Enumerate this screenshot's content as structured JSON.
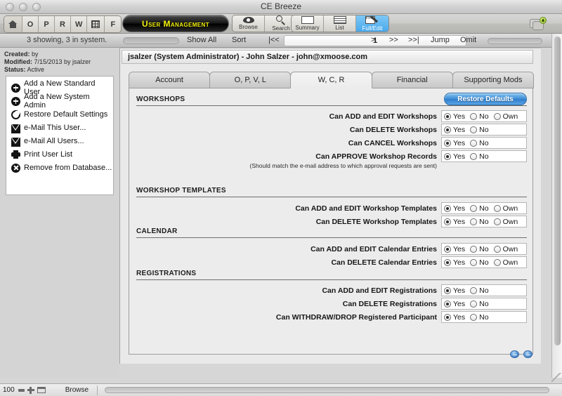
{
  "window": {
    "title": "CE Breeze",
    "traffic_lights": [
      "close",
      "minimize",
      "zoom"
    ]
  },
  "toolbar": {
    "nav_buttons": [
      {
        "name": "home",
        "label": "",
        "icon": "house-icon"
      },
      {
        "name": "o",
        "label": "O",
        "icon": ""
      },
      {
        "name": "p",
        "label": "P",
        "icon": ""
      },
      {
        "name": "r",
        "label": "R",
        "icon": ""
      },
      {
        "name": "w",
        "label": "W",
        "icon": ""
      },
      {
        "name": "grid",
        "label": "",
        "icon": "grid-icon"
      },
      {
        "name": "f",
        "label": "F",
        "icon": ""
      }
    ],
    "app_title": "User Management",
    "app_title_color": "#f2f008",
    "mode_buttons": [
      {
        "name": "browse",
        "label": "Browse",
        "icon": "eye-icon",
        "selected": false
      },
      {
        "name": "search",
        "label": "Search",
        "icon": "magnifier-icon",
        "selected": false
      }
    ],
    "view_buttons": [
      {
        "name": "summary",
        "label": "Summary",
        "icon": "summary-icon",
        "selected": false
      },
      {
        "name": "list",
        "label": "List",
        "icon": "list-icon",
        "selected": false
      },
      {
        "name": "full-edit",
        "label": "Full/Edit",
        "icon": "pencil-icon",
        "selected": true
      }
    ],
    "selected_accent": "#49a9ec",
    "new_window_icon": "new-window-icon"
  },
  "navstrip": {
    "found_count": "3 showing, 3 in system.",
    "show_all": "Show All",
    "sort": "Sort",
    "first": "|<<",
    "prev_set": "<<",
    "prev": "<",
    "page": "1",
    "next": ">",
    "next_set": ">>",
    "last": ">>|",
    "jump": "Jump",
    "omit": "Omit"
  },
  "sidebar": {
    "meta": {
      "created_label": "Created:",
      "created_value": "by",
      "modified_label": "Modified:",
      "modified_value": "7/15/2013 by jsalzer",
      "status_label": "Status:",
      "status_value": "Active"
    },
    "actions": [
      {
        "label": "Add a New Standard User",
        "icon": "plus-circle-icon"
      },
      {
        "label": "Add a New System Admin",
        "icon": "plus-circle-icon"
      },
      {
        "label": "Restore Default Settings",
        "icon": "refresh-circle-icon"
      },
      {
        "label": "e-Mail This User...",
        "icon": "envelope-icon"
      },
      {
        "label": "e-Mail All Users...",
        "icon": "envelope-icon"
      },
      {
        "label": "Print User List",
        "icon": "printer-icon"
      },
      {
        "label": "Remove from Database...",
        "icon": "x-circle-icon"
      }
    ]
  },
  "main": {
    "record_header": "jsalzer (System Administrator) - John Salzer - john@xmoose.com",
    "tabs": [
      {
        "label": "Account",
        "active": false
      },
      {
        "label": "O, P, V, L",
        "active": false
      },
      {
        "label": "W, C, R",
        "active": true
      },
      {
        "label": "Financial",
        "active": false
      },
      {
        "label": "Supporting Mods",
        "active": false
      }
    ],
    "restore_defaults_label": "Restore Defaults",
    "restore_defaults_color": "#3f8fd8",
    "sections": [
      {
        "title": "WORKSHOPS",
        "rows": [
          {
            "label": "Can ADD and EDIT Workshops",
            "options": [
              {
                "label": "Yes",
                "selected": true
              },
              {
                "label": "No",
                "selected": false
              },
              {
                "label": "Own",
                "selected": false
              }
            ],
            "note": ""
          },
          {
            "label": "Can DELETE Workshops",
            "options": [
              {
                "label": "Yes",
                "selected": true
              },
              {
                "label": "No",
                "selected": false
              }
            ],
            "note": ""
          },
          {
            "label": "Can CANCEL Workshops",
            "options": [
              {
                "label": "Yes",
                "selected": true
              },
              {
                "label": "No",
                "selected": false
              }
            ],
            "note": ""
          },
          {
            "label": "Can APPROVE Workshop Records",
            "options": [
              {
                "label": "Yes",
                "selected": true
              },
              {
                "label": "No",
                "selected": false
              }
            ],
            "note": "(Should match the e-mail address to which approval requests are sent)"
          }
        ]
      },
      {
        "title": "WORKSHOP TEMPLATES",
        "rows": [
          {
            "label": "Can ADD and EDIT Workshop Templates",
            "options": [
              {
                "label": "Yes",
                "selected": true
              },
              {
                "label": "No",
                "selected": false
              },
              {
                "label": "Own",
                "selected": false
              }
            ],
            "note": ""
          },
          {
            "label": "Can DELETE Workshop Templates",
            "options": [
              {
                "label": "Yes",
                "selected": true
              },
              {
                "label": "No",
                "selected": false
              },
              {
                "label": "Own",
                "selected": false
              }
            ],
            "note": ""
          }
        ]
      },
      {
        "title": "CALENDAR",
        "rows": [
          {
            "label": "Can ADD and EDIT Calendar Entries",
            "options": [
              {
                "label": "Yes",
                "selected": true
              },
              {
                "label": "No",
                "selected": false
              },
              {
                "label": "Own",
                "selected": false
              }
            ],
            "note": ""
          },
          {
            "label": "Can DELETE Calendar Entries",
            "options": [
              {
                "label": "Yes",
                "selected": true
              },
              {
                "label": "No",
                "selected": false
              },
              {
                "label": "Own",
                "selected": false
              }
            ],
            "note": ""
          }
        ]
      },
      {
        "title": "REGISTRATIONS",
        "rows": [
          {
            "label": "Can ADD and EDIT Registrations",
            "options": [
              {
                "label": "Yes",
                "selected": true
              },
              {
                "label": "No",
                "selected": false
              }
            ],
            "note": ""
          },
          {
            "label": "Can DELETE Registrations",
            "options": [
              {
                "label": "Yes",
                "selected": true
              },
              {
                "label": "No",
                "selected": false
              }
            ],
            "note": ""
          },
          {
            "label": "Can WITHDRAW/DROP Registered Participant",
            "options": [
              {
                "label": "Yes",
                "selected": true
              },
              {
                "label": "No",
                "selected": false
              }
            ],
            "note": ""
          }
        ]
      }
    ]
  },
  "statusbar": {
    "zoom_level": "100",
    "mode": "Browse"
  }
}
